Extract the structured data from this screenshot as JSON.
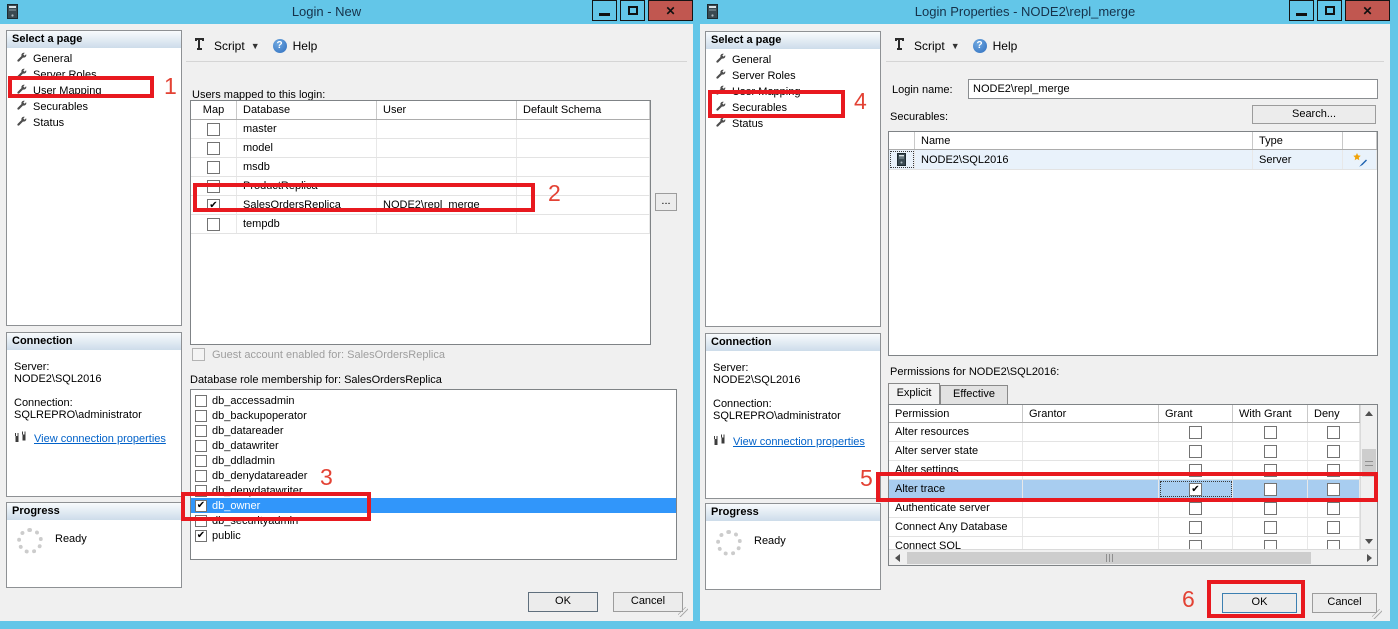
{
  "colors": {
    "titlebar_blue": "#63C6E8",
    "annotation_red": "#E8191F",
    "selection_blue": "#3196FA",
    "row_highlight_blue": "#A8CDF0",
    "link_blue": "#0262C9",
    "close_button_red": "#C15750"
  },
  "icons": {
    "close": "✕",
    "dropdown_arrow": "▼",
    "help": "?",
    "ellipsis": "..."
  },
  "annotations": [
    "1",
    "2",
    "3",
    "4",
    "5",
    "6"
  ],
  "left": {
    "title": "Login - New",
    "sidebar": {
      "select_page_header": "Select a page",
      "pages": [
        "General",
        "Server Roles",
        "User Mapping",
        "Securables",
        "Status"
      ],
      "connection_header": "Connection",
      "server_label": "Server:",
      "server_value": "NODE2\\SQL2016",
      "connection_label": "Connection:",
      "connection_value": "SQLREPRO\\administrator",
      "view_connection_link": "View connection properties",
      "progress_header": "Progress",
      "progress_status": "Ready"
    },
    "toolbar": {
      "script": "Script",
      "help": "Help"
    },
    "users_mapped_label": "Users mapped to this login:",
    "mapping_table": {
      "headers": [
        "Map",
        "Database",
        "User",
        "Default Schema"
      ],
      "rows": [
        {
          "map": "",
          "database": "master",
          "user": "",
          "default_schema": ""
        },
        {
          "map": "",
          "database": "model",
          "user": "",
          "default_schema": ""
        },
        {
          "map": "",
          "database": "msdb",
          "user": "",
          "default_schema": ""
        },
        {
          "map": "",
          "database": "ProductReplica",
          "user": "",
          "default_schema": ""
        },
        {
          "map": "✔",
          "database": "SalesOrdersReplica",
          "user": "NODE2\\repl_merge",
          "default_schema": ""
        },
        {
          "map": "",
          "database": "tempdb",
          "user": "",
          "default_schema": ""
        }
      ]
    },
    "guest_account_label": "Guest account enabled for: SalesOrdersReplica",
    "role_membership_label": "Database role membership for: SalesOrdersReplica",
    "roles": [
      {
        "checked": "",
        "name": "db_accessadmin"
      },
      {
        "checked": "",
        "name": "db_backupoperator"
      },
      {
        "checked": "",
        "name": "db_datareader"
      },
      {
        "checked": "",
        "name": "db_datawriter"
      },
      {
        "checked": "",
        "name": "db_ddladmin"
      },
      {
        "checked": "",
        "name": "db_denydatareader"
      },
      {
        "checked": "",
        "name": "db_denydatawriter"
      },
      {
        "checked": "✔",
        "name": "db_owner"
      },
      {
        "checked": "",
        "name": "db_securityadmin"
      },
      {
        "checked": "✔",
        "name": "public"
      }
    ],
    "ok_button": "OK",
    "cancel_button": "Cancel"
  },
  "right": {
    "title": "Login Properties - NODE2\\repl_merge",
    "sidebar": {
      "select_page_header": "Select a page",
      "pages": [
        "General",
        "Server Roles",
        "User Mapping",
        "Securables",
        "Status"
      ],
      "connection_header": "Connection",
      "server_label": "Server:",
      "server_value": "NODE2\\SQL2016",
      "connection_label": "Connection:",
      "connection_value": "SQLREPRO\\administrator",
      "view_connection_link": "View connection properties",
      "progress_header": "Progress",
      "progress_status": "Ready"
    },
    "toolbar": {
      "script": "Script",
      "help": "Help"
    },
    "login_name_label": "Login name:",
    "login_name_value": "NODE2\\repl_merge",
    "securables_label": "Securables:",
    "search_button": "Search...",
    "securables_table": {
      "name_header": "Name",
      "type_header": "Type",
      "rows": [
        {
          "name": "NODE2\\SQL2016",
          "type": "Server"
        }
      ]
    },
    "permissions_label": "Permissions for NODE2\\SQL2016:",
    "tabs": [
      "Explicit",
      "Effective"
    ],
    "permissions_table": {
      "headers": [
        "Permission",
        "Grantor",
        "Grant",
        "With Grant",
        "Deny"
      ],
      "rows": [
        {
          "permission": "Alter resources",
          "grantor": "",
          "grant": "",
          "with_grant": "",
          "deny": ""
        },
        {
          "permission": "Alter server state",
          "grantor": "",
          "grant": "",
          "with_grant": "",
          "deny": ""
        },
        {
          "permission": "Alter settings",
          "grantor": "",
          "grant": "",
          "with_grant": "",
          "deny": ""
        },
        {
          "permission": "Alter trace",
          "grantor": "",
          "grant": "✔",
          "with_grant": "",
          "deny": ""
        },
        {
          "permission": "Authenticate server",
          "grantor": "",
          "grant": "",
          "with_grant": "",
          "deny": ""
        },
        {
          "permission": "Connect Any Database",
          "grantor": "",
          "grant": "",
          "with_grant": "",
          "deny": ""
        },
        {
          "permission": "Connect SQL",
          "grantor": "",
          "grant": "",
          "with_grant": "",
          "deny": ""
        }
      ]
    },
    "ok_button": "OK",
    "cancel_button": "Cancel"
  }
}
